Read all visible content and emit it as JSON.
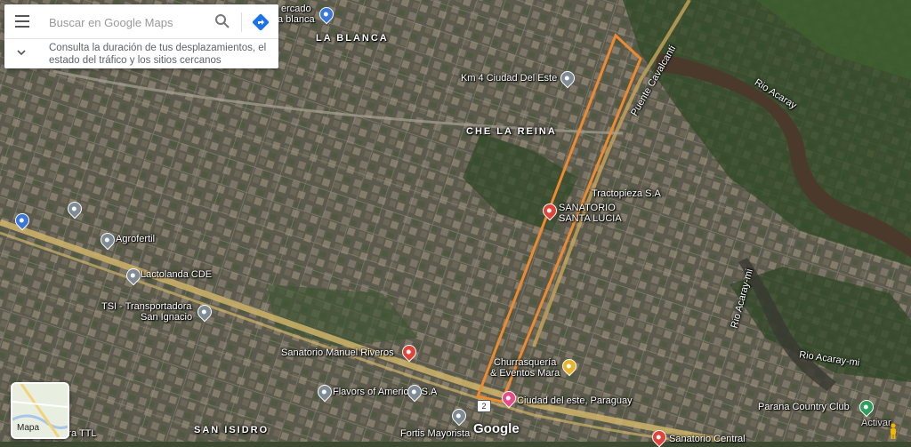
{
  "search": {
    "placeholder": "Buscar en Google Maps",
    "hint": "Consulta la duración de tus desplazamientos, el estado del tráfico y los sitios cercanos"
  },
  "areas": {
    "la_blanca": "LA BLANCA",
    "che_la_reina": "CHE LA REINA",
    "san_isidro": "SAN ISIDRO"
  },
  "places": {
    "mercado": "ercado",
    "mercado_line2": "a blanca",
    "km4": "Km 4 Ciudad Del Este",
    "tractopieza": "Tractopieza S.A",
    "sanatorio_santa_lucia": "SANATORIO",
    "sanatorio_santa_lucia_2": "SANTA LUCIA",
    "agrofertil": "Agrofertil",
    "lactolanda": "Lactolanda CDE",
    "tsi": "TSI - Transportadora",
    "tsi_2": "San Ignacio",
    "sanatorio_riveros": "Sanatorio Manuel Riveros",
    "churrasqueria": "Churrasquería",
    "churrasqueria_2": "& Eventos Mara",
    "flavors": "Flavors of Americas S.A",
    "ciudad_del_este": "Ciudad del este, Paraguay",
    "fortis": "Fortis Mayorista",
    "sanatorio_central": "Sanatorio Central",
    "parana": "Parana Country Club",
    "adora": "adora TTL"
  },
  "water": {
    "rio_acaray": "Rio Acaray",
    "rio_acaray_mi": "Rio Acaray-mi",
    "rio_acaray_mi_2": "Rio Acaray-mi"
  },
  "roads": {
    "puente": "Puente Cavalcanti",
    "route_number": "2"
  },
  "controls": {
    "layer_label": "Mapa",
    "watermark": "Activar"
  },
  "brand": {
    "logo": "Google"
  },
  "colors": {
    "highlight": "#f08a2e",
    "highway": "#e8c46a",
    "accent_blue": "#1a73e8"
  }
}
